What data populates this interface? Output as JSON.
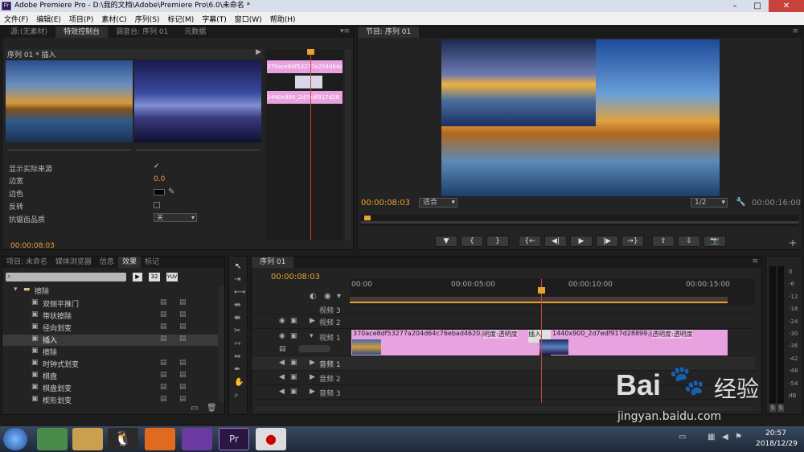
{
  "window": {
    "title": "Adobe Premiere Pro - D:\\我的文档\\Adobe\\Premiere Pro\\6.0\\未命名 *",
    "app_icon": "Pr"
  },
  "menu": [
    "文件(F)",
    "编辑(E)",
    "项目(P)",
    "素材(C)",
    "序列(S)",
    "标记(M)",
    "字幕(T)",
    "窗口(W)",
    "帮助(H)"
  ],
  "effect_panel": {
    "tabs": [
      "源:(无素材)",
      "特效控制台",
      "调音台: 序列 01",
      "元数据"
    ],
    "header": "序列 01 * 插入",
    "clip_a_label": "370ace8df53277a204d64c",
    "clip_b_label": "1440x900_2d7edf917d28",
    "props": [
      {
        "label": "显示实际来源",
        "value": "✓"
      },
      {
        "label": "边宽",
        "value": "0.0"
      },
      {
        "label": "边色",
        "value": ""
      },
      {
        "label": "反转",
        "value": ""
      },
      {
        "label": "抗锯齿品质",
        "value": "关"
      }
    ],
    "timecode": "00:00:08:03"
  },
  "program": {
    "tab": "节目: 序列 01",
    "timecode": "00:00:08:03",
    "fit": "适合",
    "resolution": "1/2",
    "duration": "00:00:16:00",
    "transport": [
      "▼",
      "{",
      "}",
      "{←",
      "◀|",
      "▶",
      "|▶",
      "→}",
      "⇪",
      "⇩",
      "📷"
    ]
  },
  "project": {
    "tabs": [
      "项目: 未命名",
      "媒体浏览器",
      "信息",
      "效果",
      "标记"
    ],
    "folder": "擦除",
    "items": [
      "双侧平推门",
      "带状擦除",
      "径向划变",
      "插入",
      "擦除",
      "时钟式划变",
      "棋盘",
      "棋盘划变",
      "楔形划变"
    ],
    "size_btns": [
      "32",
      "YUV"
    ]
  },
  "timeline": {
    "tab": "序列 01",
    "timecode": "00:00:08:03",
    "ruler": [
      "00:00",
      "00:00:05:00",
      "00:00:10:00",
      "00:00:15:00"
    ],
    "tracks": [
      {
        "name": "视频 3"
      },
      {
        "name": "视频 2"
      },
      {
        "name": "视频 1"
      },
      {
        "name": "音频 1"
      },
      {
        "name": "音频 2"
      },
      {
        "name": "音频 3"
      }
    ],
    "clip1": "370ace8df53277a204d64c76ebad4620.jpg",
    "clip1_fx": "明度:透明度",
    "transition": "插入",
    "clip2": "1440x900_2d7edf917d28899.jpg",
    "clip2_fx": "透明度:透明度"
  },
  "meter": {
    "scale": [
      "0",
      "-6",
      "-12",
      "-18",
      "-24",
      "-30",
      "-36",
      "-42",
      "-48",
      "-54",
      "dB"
    ],
    "solo": [
      "S",
      "S"
    ]
  },
  "watermark": {
    "line1": "Bai",
    "line2": "经验",
    "url": "jingyan.baidu.com"
  },
  "taskbar": {
    "time": "20:57",
    "date": "2018/12/29"
  },
  "colors": {
    "accent": "#e8a230",
    "clip": "#e8a2e0",
    "playhead": "#d04040"
  }
}
